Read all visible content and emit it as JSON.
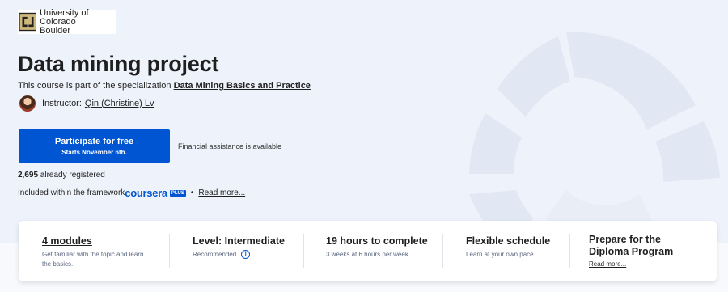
{
  "university": {
    "line1": "University of Colorado",
    "line2": "Boulder"
  },
  "course": {
    "title": "Data mining project"
  },
  "specialization": {
    "prefix": "This course is part of the specialization ",
    "name": "Data Mining Basics and Practice"
  },
  "instructor": {
    "label": "Instructor:",
    "name": "Qin (Christine) Lv"
  },
  "cta": {
    "label": "Participate for free",
    "sublabel": "Starts November 6th."
  },
  "financial_aid": "Financial assistance is available",
  "registered": {
    "count": "2,695",
    "suffix": " already registered"
  },
  "included": {
    "prefix": "Included within the framework",
    "brand": "coursera",
    "badge": "PLUS",
    "separator": "•",
    "more": "Read more..."
  },
  "stats": [
    {
      "heading": "4 modules",
      "sub": "Get familiar with the topic and learn the basics."
    },
    {
      "heading": "Level: Intermediate",
      "sub": "Recommended"
    },
    {
      "heading": "19 hours to complete",
      "sub": "3 weeks at 6 hours per week"
    },
    {
      "heading": "Flexible schedule",
      "sub": "Learn at your own pace"
    },
    {
      "heading": "Prepare for the Diploma Program",
      "sub": "Read more..."
    }
  ],
  "colors": {
    "accent": "#0056d2",
    "background": "#eef2fa",
    "logo_gold": "#cfb87c"
  }
}
